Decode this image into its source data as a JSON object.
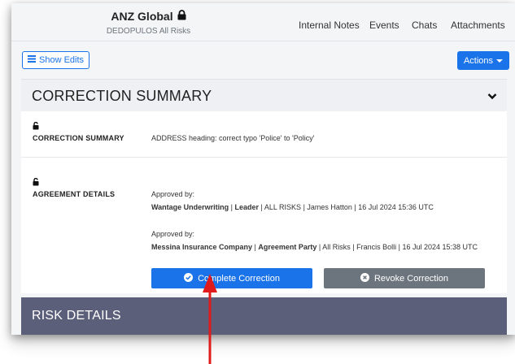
{
  "header": {
    "title": "ANZ Global",
    "subtitle": "DEDOPULOS All Risks",
    "nav": [
      "Internal Notes",
      "Events",
      "Chats",
      "Attachments"
    ]
  },
  "toolbar": {
    "show_edits": "Show Edits",
    "actions": "Actions"
  },
  "correction_summary": {
    "section_title": "CORRECTION SUMMARY",
    "field_label": "CORRECTION SUMMARY",
    "field_value": "ADDRESS heading: correct typo 'Police' to 'Policy'"
  },
  "agreement": {
    "label": "AGREEMENT DETAILS",
    "approvals": [
      {
        "approved_by": "Approved by:",
        "company": "Wantage Underwriting",
        "role": "Leader",
        "rest": "ALL RISKS | James Hatton | 16 Jul 2024 15:36 UTC"
      },
      {
        "approved_by": "Approved by:",
        "company": "Messina Insurance Company",
        "role": "Agreement Party",
        "rest": "All Risks | Francis Bolli | 16 Jul 2024 15:38 UTC"
      }
    ]
  },
  "buttons": {
    "complete": "Complete Correction",
    "revoke": "Revoke Correction"
  },
  "risk_details": {
    "title": "RISK DETAILS"
  },
  "colors": {
    "primary": "#1a73e8",
    "secondary": "#6c757d",
    "risk_bar": "#5c5f7a",
    "annotation_arrow": "#e01b1b"
  }
}
